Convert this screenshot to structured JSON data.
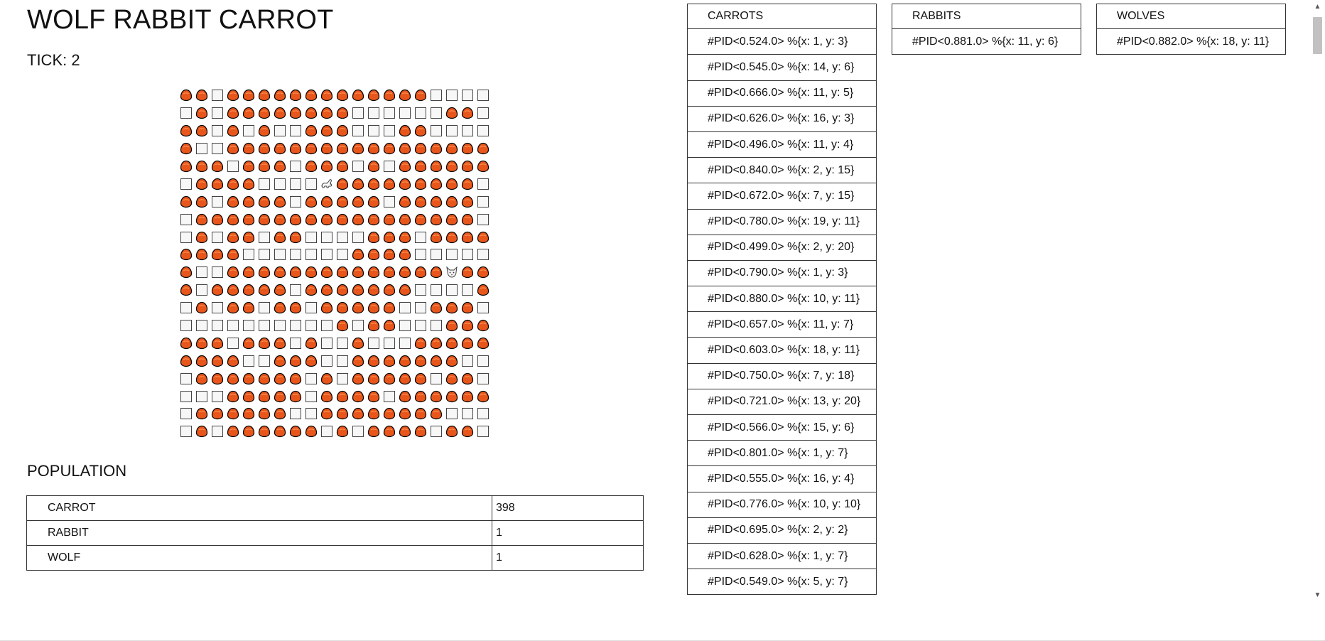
{
  "title": "WOLF RABBIT CARROT",
  "tick_label": "TICK: 2",
  "grid": {
    "rows": [
      "CCECCCCCCCCCCCCCEEEE",
      "ECECCCCCCCCEEEEEECCE",
      "CCECECEECCCEEECCEEEE",
      "CEECCCCCCCCCCCCCCCCC",
      "CCCECCCECCCECECCCCCC",
      "ECCCCEEEERCCCCCCCCCE",
      "CCECCCCECCCCCECCCCCE",
      "ECCCCCCCCCCCCCCCCCCE",
      "ECECCECCEEEECCCECCCC",
      "CCCCEEEEEEECCCCEEEEE",
      "CEECCCCCCCCCCCCCCWCC",
      "CECCCCCECCCCCCCEEEEC",
      "ECECCECCECCCCCEECCCE",
      "EEEEEEEEEECECCEEECCC",
      "CCCECCCECEECEEECCCCC",
      "CCCCEECCCEECCCCCCCEE",
      "ECCCCCCCECECCCCCECCE",
      "EEECCCCCECCCCECCCCCC",
      "ECCCCCCEECCCCCCCCEEE",
      "ECECCCCCCECECCCCECCE"
    ],
    "legend": {
      "C": "carrot",
      "E": "empty",
      "R": "rabbit",
      "W": "wolf"
    },
    "colors": {
      "carrot": "#e8561b",
      "carrot_outline": "#000000",
      "empty": "#f7f7f7"
    }
  },
  "population": {
    "heading": "POPULATION",
    "rows": [
      {
        "name": "CARROT",
        "count": "398"
      },
      {
        "name": "RABBIT",
        "count": "1"
      },
      {
        "name": "WOLF",
        "count": "1"
      }
    ]
  },
  "carrots": {
    "header": "CARROTS",
    "items": [
      "#PID<0.524.0> %{x: 1, y: 3}",
      "#PID<0.545.0> %{x: 14, y: 6}",
      "#PID<0.666.0> %{x: 11, y: 5}",
      "#PID<0.626.0> %{x: 16, y: 3}",
      "#PID<0.496.0> %{x: 11, y: 4}",
      "#PID<0.840.0> %{x: 2, y: 15}",
      "#PID<0.672.0> %{x: 7, y: 15}",
      "#PID<0.780.0> %{x: 19, y: 11}",
      "#PID<0.499.0> %{x: 2, y: 20}",
      "#PID<0.790.0> %{x: 1, y: 3}",
      "#PID<0.880.0> %{x: 10, y: 11}",
      "#PID<0.657.0> %{x: 11, y: 7}",
      "#PID<0.603.0> %{x: 18, y: 11}",
      "#PID<0.750.0> %{x: 7, y: 18}",
      "#PID<0.721.0> %{x: 13, y: 20}",
      "#PID<0.566.0> %{x: 15, y: 6}",
      "#PID<0.801.0> %{x: 1, y: 7}",
      "#PID<0.555.0> %{x: 16, y: 4}",
      "#PID<0.776.0> %{x: 10, y: 10}",
      "#PID<0.695.0> %{x: 2, y: 2}",
      "#PID<0.628.0> %{x: 1, y: 7}",
      "#PID<0.549.0> %{x: 5, y: 7}"
    ]
  },
  "rabbits": {
    "header": "RABBITS",
    "items": [
      "#PID<0.881.0> %{x: 11, y: 6}"
    ]
  },
  "wolves": {
    "header": "WOLVES",
    "items": [
      "#PID<0.882.0> %{x: 18, y: 11}"
    ]
  },
  "scrollbar": {
    "up_icon": "triangle-up",
    "down_icon": "triangle-down"
  }
}
